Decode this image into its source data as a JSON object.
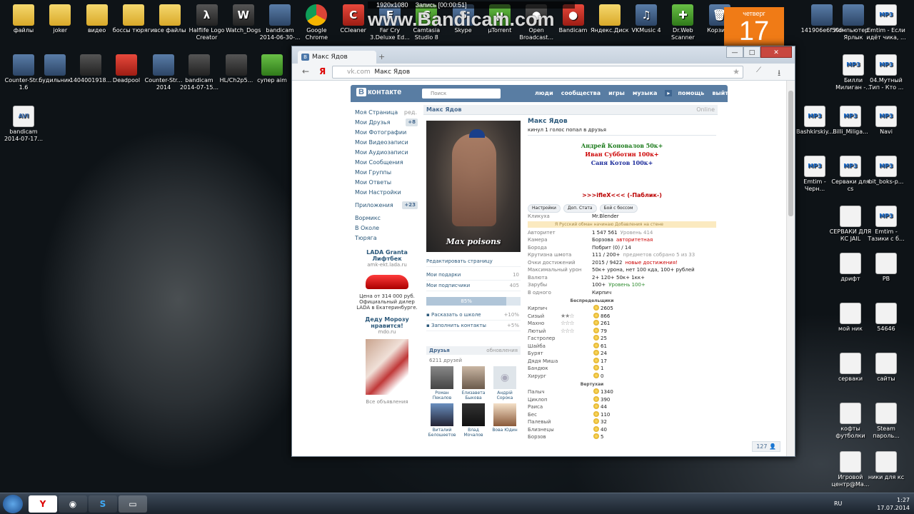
{
  "desktop": {
    "icons_row1": [
      "файлы",
      "joker",
      "видео",
      "боссы тюряги",
      "все файлы",
      "Halflife Logo Creator",
      "Watch_Dogs",
      "bandicam 2014-06-30-...",
      "Google Chrome",
      "CCleaner",
      "Far Cry 3.Deluxe Ed...",
      "Camtasia Studio 8",
      "Skype",
      "µTorrent",
      "Open Broadcast...",
      "Bandicam",
      "Яндекс.Диск",
      "VKMusic 4",
      "Dr.Web Scanner",
      "Корзина"
    ],
    "icons_row2": [
      "Counter-Str... 1.6",
      "будильник",
      "1404001918...",
      "Deadpool",
      "Counter-Str... 2014",
      "bandicam 2014-07-15...",
      "HL/Ch2p5...",
      "супер aim"
    ],
    "icon_row3": "bandicam 2014-07-17...",
    "right_icons": [
      "141906e6f586",
      "Компьютер - Ярлык",
      "Emtim - Если идёт чика, ...",
      "Билли Милиган -...",
      "04.Мутный Тип - Кто ...",
      "Bashkirskiy...",
      "Billi_Miliga...",
      "Navi",
      "Emtim - Черн...",
      "Серваки для cs",
      "bit_boks-p...",
      "СЕРВАКИ ДЛЯ КС JAIL",
      "Emtim - Тазики с б...",
      "дрифт",
      "PB",
      "мой ник",
      "54646",
      "серваки",
      "сайты",
      "кофты футболки",
      "Steam пароль...",
      "Игровой центр@Ma...",
      "ники для кс"
    ]
  },
  "calendar": {
    "day": "четверг",
    "num": "17"
  },
  "bandicam": {
    "res": "1920x1080",
    "rec": "Запись [00:00:51]",
    "brand": "www.Bandicam.com"
  },
  "browser": {
    "tab": "Макс Ядов",
    "url_host": "vk.com",
    "url_title": "Макс Ядов",
    "min": "—",
    "max": "□",
    "close": "✕"
  },
  "vk": {
    "logo": "контакте",
    "search": "Поиск",
    "nav": [
      "люди",
      "сообщества",
      "игры",
      "музыка",
      "помощь",
      "выйти"
    ],
    "menu": [
      {
        "l": "Моя Страница",
        "c": "ред."
      },
      {
        "l": "Мои Друзья",
        "c": "+8"
      },
      {
        "l": "Мои Фотографии"
      },
      {
        "l": "Мои Видеозаписи"
      },
      {
        "l": "Мои Аудиозаписи"
      },
      {
        "l": "Мои Сообщения"
      },
      {
        "l": "Мои Группы"
      },
      {
        "l": "Мои Ответы"
      },
      {
        "l": "Мои Настройки"
      },
      {
        "l": "Приложения",
        "c": "+23"
      },
      {
        "l": "Вормикс"
      },
      {
        "l": "В Околе"
      },
      {
        "l": "Тюряга"
      }
    ],
    "ad": {
      "t1": "LADA Granta",
      "t2": "Лифтбек",
      "url": "amk-ekt.lada.ru",
      "text": "Цена от 314 000 руб. Официальный дилер LADA в Екатеринбурге.",
      "t3": "Деду Морозу нравится!",
      "url2": "mdo.ru",
      "all": "Все объявления"
    },
    "profile": {
      "head": "Макс Ядов",
      "online": "Online",
      "name": "Макс Ядов",
      "status": "кинул 1 голос попал в друзья",
      "avatar_caption": "Max poisons",
      "clans": [
        "Андрей Коновалов 50к+",
        "Иван Субботин 100к+",
        "Саня Котов 100к+"
      ],
      "public": ">>>ifleX<<< (-Паблик-)",
      "edit": "Редактировать страницу",
      "gifts": "Мои подарки",
      "gifts_c": "10",
      "subs": "Мои подписчики",
      "subs_c": "405",
      "progress": "85%",
      "school": "Расказать о школе",
      "school_c": "+10%",
      "contacts": "Заполнить контакты",
      "contacts_c": "+5%",
      "friends_h": "Друзья",
      "friends_u": "обновления",
      "friends_c": "6211 друзей",
      "friends": [
        "Роман Пекалов",
        "Елизавета Быкова",
        "Андрій Сорока",
        "Виталий Белошеетов",
        "Влад Мочалов",
        "Вова Юдин"
      ],
      "tabs": [
        "Настройки",
        "Доп. Стата",
        "Бой с боссом"
      ],
      "banner": "Я Русский обман начинаю Добавления на стене",
      "stats": [
        {
          "k": "Кликуха",
          "v": "Mr.Blender"
        },
        {
          "k": "Авторитет",
          "v": "1 547 561",
          "g": "Уровень 414"
        },
        {
          "k": "Камера",
          "v": "Борзова",
          "r": "авторитетная"
        },
        {
          "k": "Борода",
          "v": "Побрит (0) / 14"
        },
        {
          "k": "Крутизна шмота",
          "v": "111 / 200+",
          "g": "предметов собрано 5 из 33"
        },
        {
          "k": "Очки достижений",
          "v": "2015 / 9422",
          "r": "новые достижения!"
        },
        {
          "k": "Максимальный урон",
          "v": "50к+ урона, нет 100 кда, 100+ рублей"
        },
        {
          "k": "Валюта",
          "v": "2+  120+  50к+  1кк+"
        },
        {
          "k": "Зарубы",
          "v": "100+",
          "s": "Уровень 100+"
        },
        {
          "k": "В одного",
          "v": "Кирпич"
        }
      ],
      "sec1": "Беспредельщики",
      "bosses1": [
        {
          "k": "Кирпич",
          "st": "",
          "v": "2605"
        },
        {
          "k": "Сизый",
          "st": "★★☆",
          "v": "866"
        },
        {
          "k": "Махно",
          "st": "☆☆☆",
          "v": "261"
        },
        {
          "k": "Лютый",
          "st": "☆☆☆",
          "v": "79"
        },
        {
          "k": "Гастролер",
          "st": "",
          "v": "25"
        },
        {
          "k": "Шайба",
          "st": "",
          "v": "61"
        },
        {
          "k": "Бурят",
          "st": "",
          "v": "24"
        },
        {
          "k": "Дядя Миша",
          "st": "",
          "v": "17"
        },
        {
          "k": "Бандюк",
          "st": "",
          "v": "1"
        },
        {
          "k": "Хирург",
          "st": "",
          "v": "0"
        }
      ],
      "sec2": "Вертухаи",
      "bosses2": [
        {
          "k": "Палыч",
          "v": "1340"
        },
        {
          "k": "Циклоп",
          "v": "390"
        },
        {
          "k": "Раиса",
          "v": "44"
        },
        {
          "k": "Бес",
          "v": "110"
        },
        {
          "k": "Палевый",
          "v": "32"
        },
        {
          "k": "Близнецы",
          "v": "40"
        },
        {
          "k": "Борзов",
          "v": "5"
        }
      ],
      "online_count": "127"
    }
  },
  "taskbar": {
    "lang": "RU",
    "time": "1:27",
    "date": "17.07.2014"
  }
}
